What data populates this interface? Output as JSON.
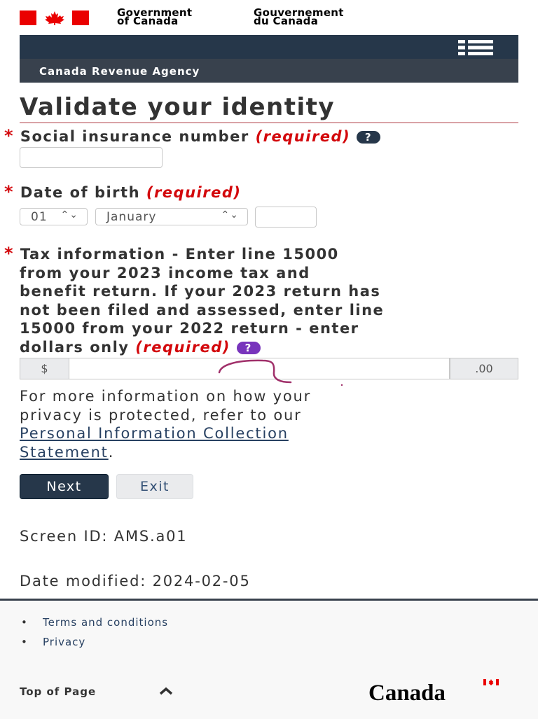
{
  "header": {
    "gov_en_line1": "Government",
    "gov_en_line2": "of Canada",
    "gov_fr_line1": "Gouvernement",
    "gov_fr_line2": "du Canada",
    "menu_icon": "menu-list-icon",
    "agency": "Canada Revenue Agency"
  },
  "page": {
    "title": "Validate your identity"
  },
  "sin": {
    "star": "*",
    "label": "Social insurance number",
    "required": "(required)",
    "help": "?",
    "value": ""
  },
  "dob": {
    "star": "*",
    "label": "Date of birth",
    "required": "(required)",
    "day": "01",
    "month": "January",
    "year": ""
  },
  "tax": {
    "star": "*",
    "label_lines": [
      "Tax information - Enter line 15000",
      "from your 2023 income tax and",
      "benefit return. If your 2023 return has",
      "not been filed and assessed, enter line",
      "15000 from your 2022 return - enter",
      "dollars only"
    ],
    "required": "(required)",
    "help": "?",
    "prefix": "$",
    "suffix": ".00",
    "value": ""
  },
  "privacy": {
    "line1": "For more information on how your",
    "line2": "privacy is protected, refer to our",
    "link_line1": "Personal Information Collection",
    "link_line2": "Statement",
    "period": "."
  },
  "buttons": {
    "next": "Next",
    "exit": "Exit"
  },
  "meta": {
    "screen_id": "Screen ID: AMS.a01",
    "date_modified": "Date modified: 2024-02-05"
  },
  "footer": {
    "links": [
      "Terms and conditions",
      "Privacy"
    ],
    "top_of_page": "Top of Page",
    "wordmark": "Canada"
  },
  "colors": {
    "header_bar": "#26374a",
    "agency_bar": "#38414d",
    "required_red": "#d3080c",
    "link": "#284162",
    "sin_help": "#26374a",
    "tax_help": "#7834bc"
  }
}
